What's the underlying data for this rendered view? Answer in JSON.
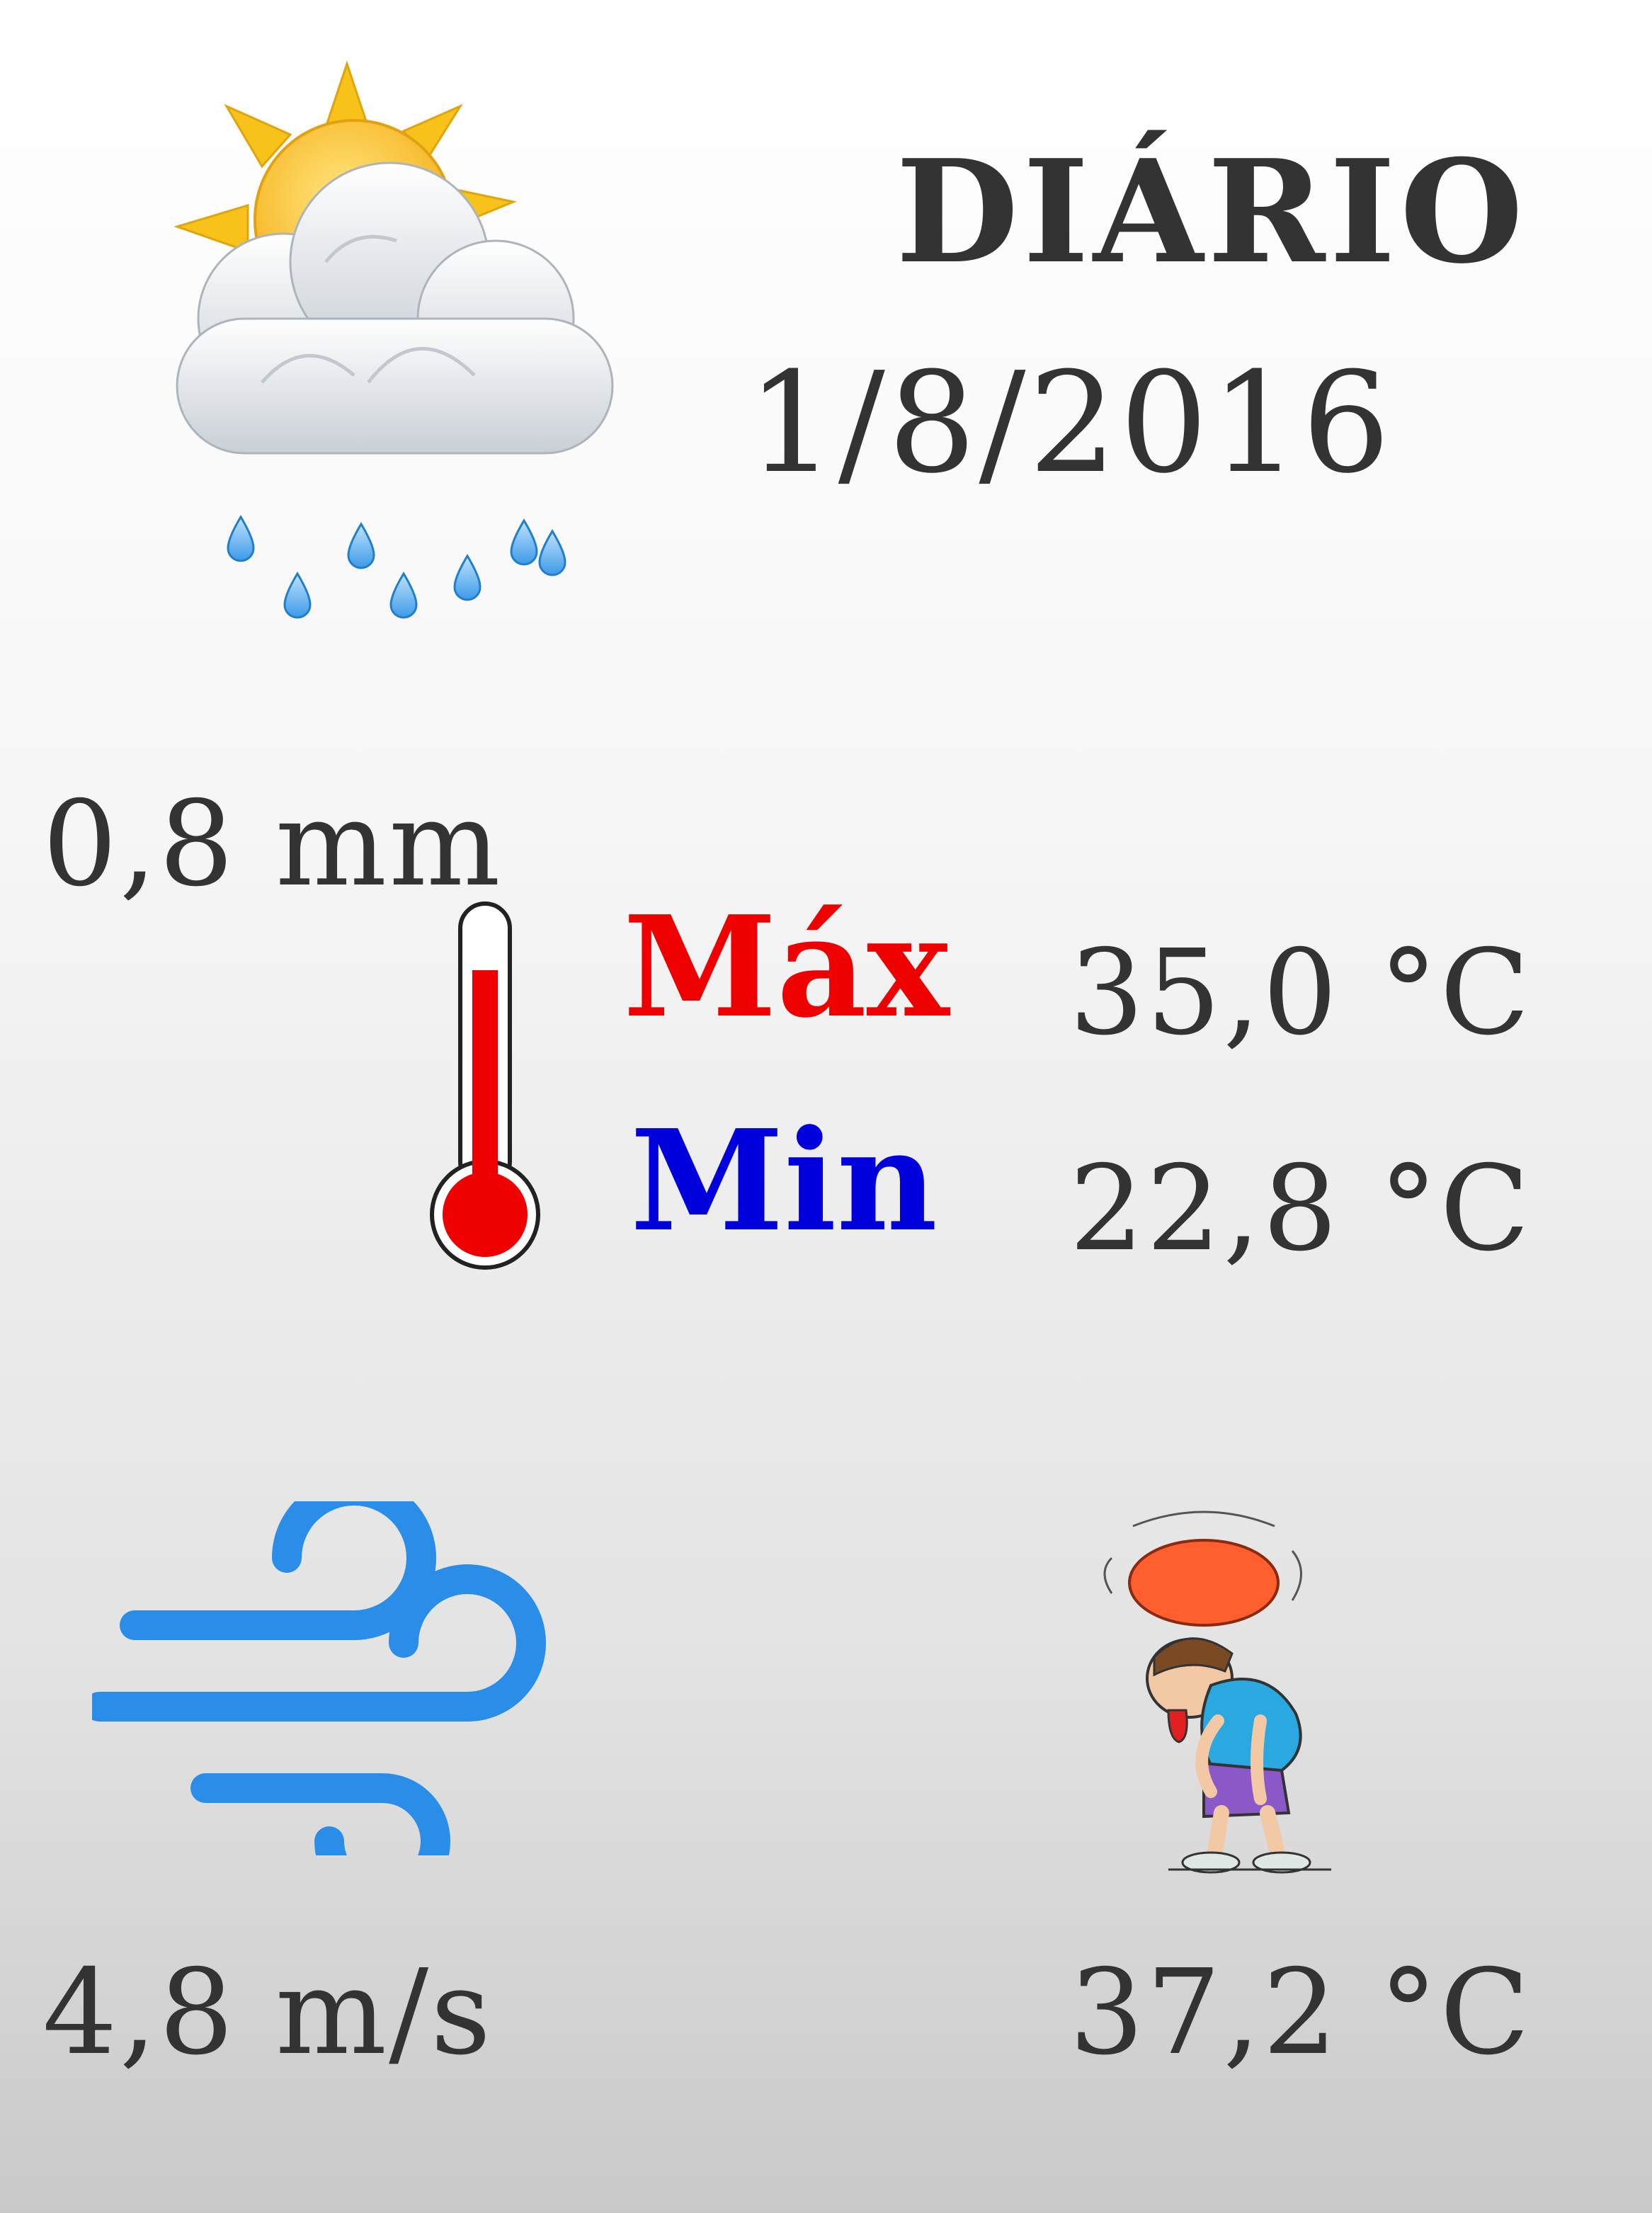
{
  "header": {
    "title": "DIÁRIO",
    "date": "1/8/2016"
  },
  "precipitation": {
    "icon": "sun-cloud-rain-icon",
    "value": "0,8 mm"
  },
  "temperature": {
    "icon": "thermometer-icon",
    "max_label": "Máx",
    "max_value": "35,0 °C",
    "min_label": "Min",
    "min_value": "22,8 °C",
    "max_color": "#ee0000",
    "min_color": "#0000dd"
  },
  "wind": {
    "icon": "wind-icon",
    "value": "4,8 m/s",
    "color": "#2a8de8"
  },
  "heat_index": {
    "icon": "overheated-person-icon",
    "value": "37,2 °C"
  }
}
